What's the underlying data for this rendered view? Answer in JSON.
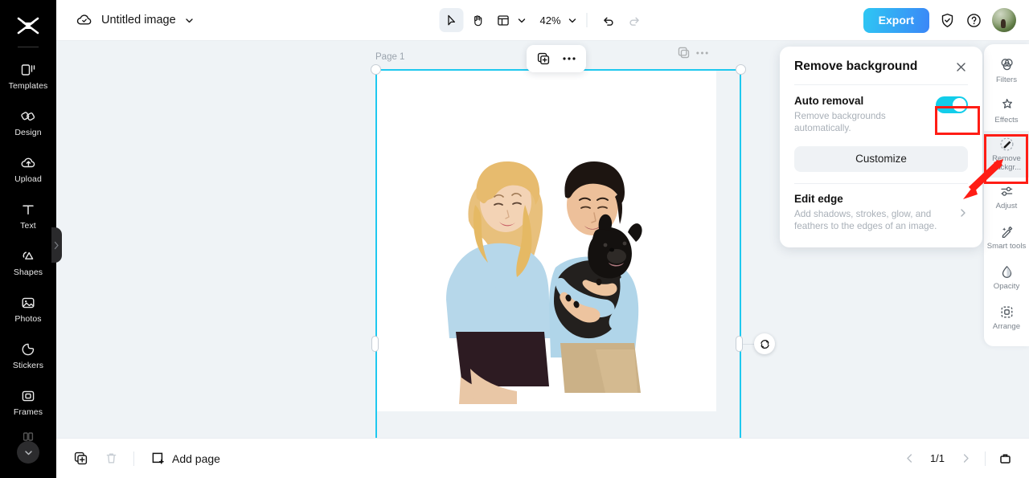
{
  "app": {
    "accent_cyan": "#12cdea",
    "highlight_red": "#ff1d15",
    "canvas_bg": "#eff3f6"
  },
  "left_rail": {
    "logo_name": "capcut-logo",
    "items": [
      {
        "label": "Templates",
        "icon": "templates-icon"
      },
      {
        "label": "Design",
        "icon": "design-icon"
      },
      {
        "label": "Upload",
        "icon": "upload-cloud-icon"
      },
      {
        "label": "Text",
        "icon": "text-icon"
      },
      {
        "label": "Shapes",
        "icon": "shapes-icon"
      },
      {
        "label": "Photos",
        "icon": "photos-icon"
      },
      {
        "label": "Stickers",
        "icon": "stickers-icon"
      },
      {
        "label": "Frames",
        "icon": "frames-icon"
      }
    ],
    "collapse_icon": "chevron-down-icon",
    "panel_handle_icon": "chevron-right-icon"
  },
  "topbar": {
    "cloud_icon": "cloud-saved-icon",
    "document_title": "Untitled image",
    "title_caret_icon": "chevron-down-icon",
    "tools": [
      {
        "name": "select-tool",
        "icon": "cursor-arrow-icon",
        "active": true
      },
      {
        "name": "hand-tool",
        "icon": "hand-icon",
        "active": false
      },
      {
        "name": "layout-tool",
        "icon": "layout-grid-icon",
        "active": false
      }
    ],
    "layout_caret_icon": "chevron-down-icon",
    "zoom_level": "42%",
    "zoom_caret_icon": "chevron-down-icon",
    "undo_icon": "undo-icon",
    "redo_icon": "redo-icon",
    "export_label": "Export",
    "shield_icon": "shield-check-icon",
    "help_icon": "help-circle-icon",
    "avatar_name": "user-avatar"
  },
  "canvas": {
    "page_label": "Page 1",
    "object_toolbar": [
      {
        "name": "duplicate-layer-button",
        "icon": "duplicate-icon"
      },
      {
        "name": "more-options-button",
        "icon": "ellipsis-icon"
      }
    ],
    "ghost_toolbar": [
      {
        "name": "duplicate-layer-ghost",
        "icon": "duplicate-icon"
      },
      {
        "name": "more-options-ghost",
        "icon": "ellipsis-icon"
      }
    ],
    "rotate_icon": "rotate-icon",
    "image_alt": "Couple sitting with a black french bulldog on white background"
  },
  "remove_bg_panel": {
    "title": "Remove background",
    "close_icon": "close-icon",
    "auto_removal": {
      "label": "Auto removal",
      "description": "Remove backgrounds automatically.",
      "toggle_on": true
    },
    "customize_label": "Customize",
    "edit_edge": {
      "label": "Edit edge",
      "description": "Add shadows, strokes, glow, and feathers to the edges of an image.",
      "chevron_icon": "chevron-right-icon"
    }
  },
  "right_rail": {
    "items": [
      {
        "label": "Filters",
        "icon": "filters-icon",
        "selected": false
      },
      {
        "label": "Effects",
        "icon": "effects-icon",
        "selected": false
      },
      {
        "label": "Remove backgr...",
        "icon": "remove-background-icon",
        "selected": true
      },
      {
        "label": "Adjust",
        "icon": "adjust-sliders-icon",
        "selected": false
      },
      {
        "label": "Smart tools",
        "icon": "smart-tools-icon",
        "selected": false
      },
      {
        "label": "Opacity",
        "icon": "opacity-drop-icon",
        "selected": false
      },
      {
        "label": "Arrange",
        "icon": "arrange-icon",
        "selected": false
      }
    ]
  },
  "bottombar": {
    "duplicate_page_icon": "duplicate-page-icon",
    "delete_page_icon": "trash-icon",
    "add_page_icon": "add-page-icon",
    "add_page_label": "Add page",
    "prev_page_icon": "chevron-left-icon",
    "page_indicator": "1/1",
    "next_page_icon": "chevron-right-icon",
    "grid_view_icon": "pages-panel-icon"
  }
}
